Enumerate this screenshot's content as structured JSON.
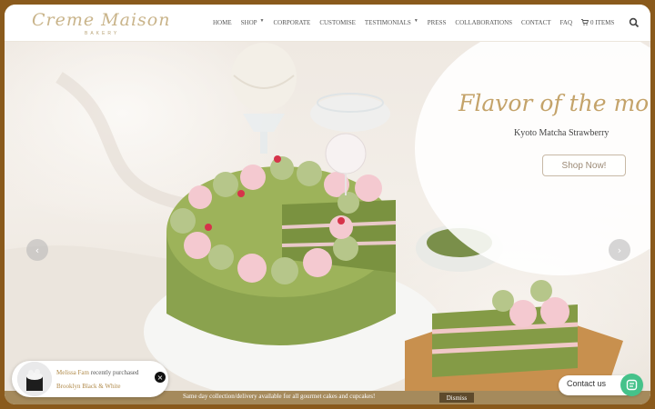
{
  "brand": {
    "logo_text": "Creme Maison",
    "logo_subtext": "BAKERY"
  },
  "nav": {
    "items": [
      {
        "label": "HOME"
      },
      {
        "label": "SHOP",
        "has_dropdown": true
      },
      {
        "label": "CORPORATE"
      },
      {
        "label": "CUSTOMISE"
      },
      {
        "label": "TESTIMONIALS",
        "has_dropdown": true
      },
      {
        "label": "PRESS"
      },
      {
        "label": "COLLABORATIONS"
      },
      {
        "label": "CONTACT"
      },
      {
        "label": "FAQ"
      }
    ],
    "cart_label": "0 ITEMS",
    "cart_icon": "cart-icon",
    "search_icon": "search-icon"
  },
  "hero": {
    "title": "Flavor of the month",
    "subtitle": "Kyoto Matcha Strawberry",
    "button_label": "Shop Now!",
    "prev_icon": "chevron-left-icon",
    "next_icon": "chevron-right-icon",
    "accent_color": "#c4a36a"
  },
  "notification": {
    "customer_name": "Melissa Fam",
    "action_text": "recently purchased",
    "product_name": "Brooklyn Black & White",
    "close_icon": "close-icon"
  },
  "contact": {
    "label": "Contact us",
    "icon": "chat-icon",
    "color": "#45c28a"
  },
  "announcement": {
    "text": "Same day collection/delivery available for all gourmet cakes and cupcakes!",
    "dismiss_label": "Dismiss",
    "background": "#a58a5c"
  }
}
